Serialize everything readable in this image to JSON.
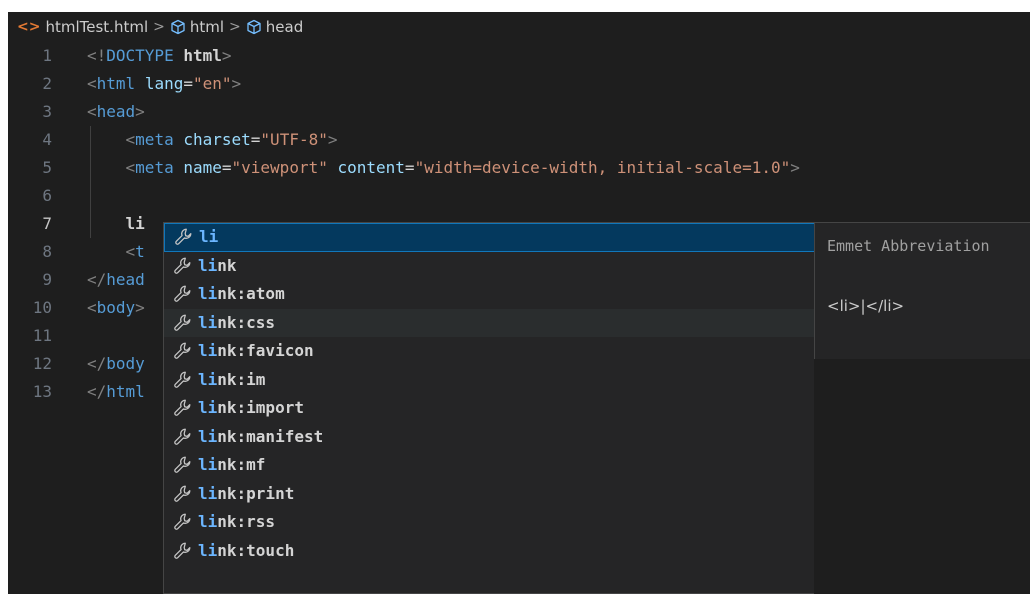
{
  "breadcrumb": {
    "file_icon": "<>",
    "file": "htmlTest.html",
    "items": [
      "html",
      "head"
    ],
    "separator": ">"
  },
  "editor": {
    "lines": [
      {
        "n": "1",
        "tokens": [
          [
            "punct",
            "<!"
          ],
          [
            "tag",
            "DOCTYPE"
          ],
          [
            "plain",
            " "
          ],
          [
            "bold",
            "html"
          ],
          [
            "punct",
            ">"
          ]
        ]
      },
      {
        "n": "2",
        "tokens": [
          [
            "punct",
            "<"
          ],
          [
            "tag",
            "html"
          ],
          [
            "plain",
            " "
          ],
          [
            "attr",
            "lang"
          ],
          [
            "plain",
            "="
          ],
          [
            "str",
            "\"en\""
          ],
          [
            "punct",
            ">"
          ]
        ]
      },
      {
        "n": "3",
        "tokens": [
          [
            "punct",
            "<"
          ],
          [
            "tag",
            "head"
          ],
          [
            "punct",
            ">"
          ]
        ]
      },
      {
        "n": "4",
        "tokens": [
          [
            "plain",
            "    "
          ],
          [
            "punct",
            "<"
          ],
          [
            "tag",
            "meta"
          ],
          [
            "plain",
            " "
          ],
          [
            "attr",
            "charset"
          ],
          [
            "plain",
            "="
          ],
          [
            "str",
            "\"UTF-8\""
          ],
          [
            "punct",
            ">"
          ]
        ]
      },
      {
        "n": "5",
        "tokens": [
          [
            "plain",
            "    "
          ],
          [
            "punct",
            "<"
          ],
          [
            "tag",
            "meta"
          ],
          [
            "plain",
            " "
          ],
          [
            "attr",
            "name"
          ],
          [
            "plain",
            "="
          ],
          [
            "str",
            "\"viewport\""
          ],
          [
            "plain",
            " "
          ],
          [
            "attr",
            "content"
          ],
          [
            "plain",
            "="
          ],
          [
            "str",
            "\"width=device-width, initial-scale=1.0\""
          ],
          [
            "punct",
            ">"
          ]
        ]
      },
      {
        "n": "6",
        "tokens": []
      },
      {
        "n": "7",
        "tokens": [
          [
            "plain",
            "    "
          ],
          [
            "bold",
            "li"
          ]
        ]
      },
      {
        "n": "8",
        "tokens": [
          [
            "plain",
            "    "
          ],
          [
            "punct",
            "<"
          ],
          [
            "tag",
            "t"
          ]
        ]
      },
      {
        "n": "9",
        "tokens": [
          [
            "punct",
            "</"
          ],
          [
            "tag",
            "head"
          ]
        ]
      },
      {
        "n": "10",
        "tokens": [
          [
            "punct",
            "<"
          ],
          [
            "tag",
            "body"
          ],
          [
            "punct",
            ">"
          ]
        ]
      },
      {
        "n": "11",
        "tokens": []
      },
      {
        "n": "12",
        "tokens": [
          [
            "punct",
            "</"
          ],
          [
            "tag",
            "body"
          ]
        ]
      },
      {
        "n": "13",
        "tokens": [
          [
            "punct",
            "</"
          ],
          [
            "tag",
            "html"
          ]
        ]
      }
    ],
    "active_line": "7"
  },
  "suggest": {
    "icon": "wrench-icon",
    "query": "li",
    "items": [
      {
        "match": "li",
        "rest": "",
        "state": "selected"
      },
      {
        "match": "li",
        "rest": "nk",
        "state": ""
      },
      {
        "match": "li",
        "rest": "nk:atom",
        "state": ""
      },
      {
        "match": "li",
        "rest": "nk:css",
        "state": "hover"
      },
      {
        "match": "li",
        "rest": "nk:favicon",
        "state": ""
      },
      {
        "match": "li",
        "rest": "nk:im",
        "state": ""
      },
      {
        "match": "li",
        "rest": "nk:import",
        "state": ""
      },
      {
        "match": "li",
        "rest": "nk:manifest",
        "state": ""
      },
      {
        "match": "li",
        "rest": "nk:mf",
        "state": ""
      },
      {
        "match": "li",
        "rest": "nk:print",
        "state": ""
      },
      {
        "match": "li",
        "rest": "nk:rss",
        "state": ""
      },
      {
        "match": "li",
        "rest": "nk:touch",
        "state": ""
      }
    ]
  },
  "details": {
    "title": "Emmet Abbreviation",
    "body": "<li>|</li>"
  },
  "colors": {
    "background": "#1e1e1e",
    "tag": "#569cd6",
    "attribute": "#9cdcfe",
    "string": "#ce9178",
    "match": "#6cb6ff",
    "selection": "#04395e"
  }
}
